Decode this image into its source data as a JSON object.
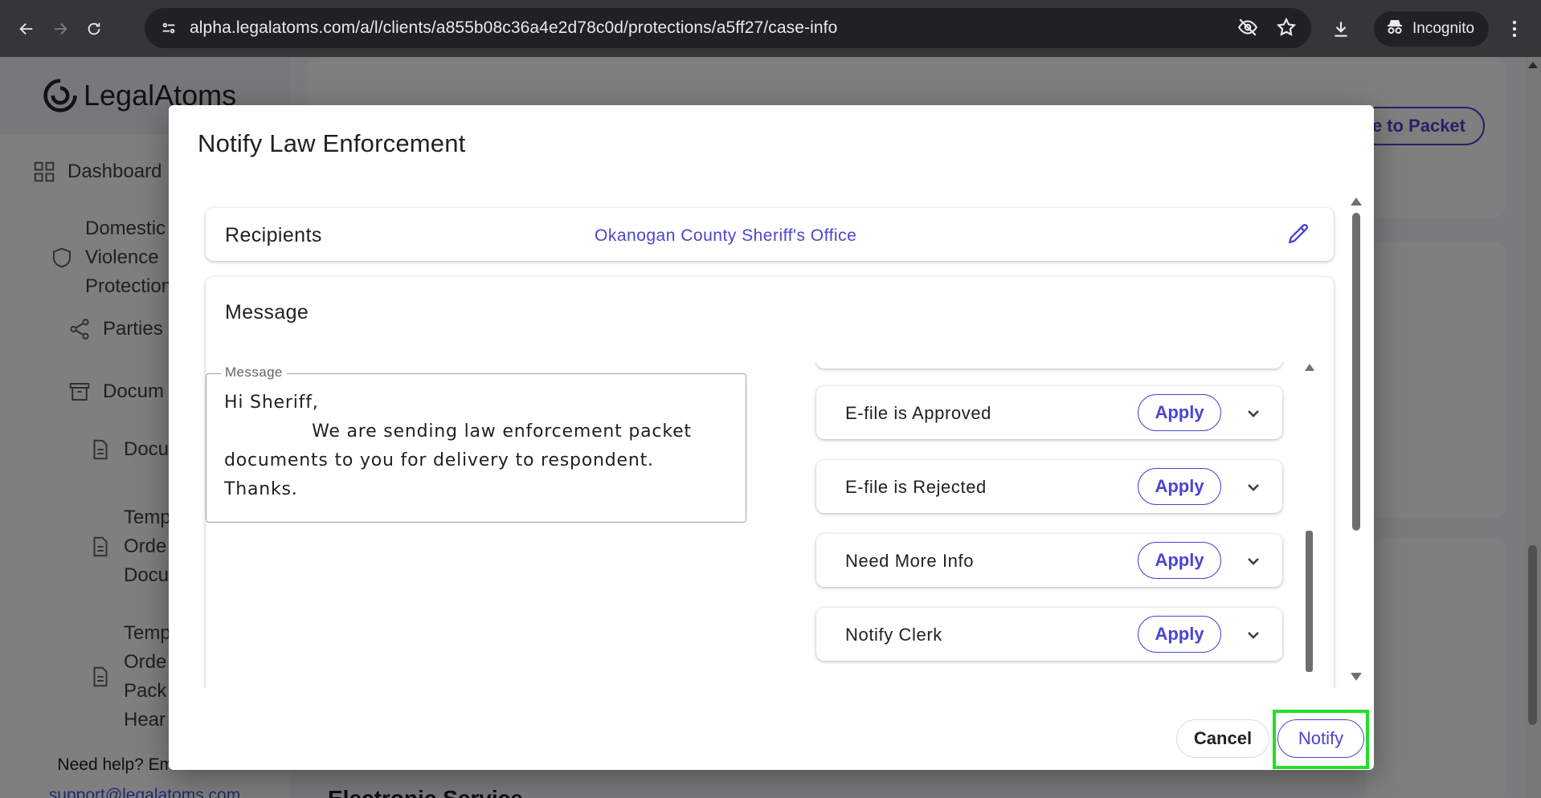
{
  "browser": {
    "url": "alpha.legalatoms.com/a/l/clients/a855b08c36a4e2d78c0d/protections/a5ff27/case-info",
    "profile_label": "Incognito"
  },
  "sidebar": {
    "logo_text": "LegalAtoms",
    "items": [
      {
        "label": "Dashboard",
        "icon": "dashboard-grid-icon"
      },
      {
        "label": "Domestic\nViolence\nProtection",
        "icon": "shield-icon"
      },
      {
        "label": "Parties",
        "icon": "share-nodes-icon"
      },
      {
        "label": "Docum",
        "icon": "archive-box-icon"
      },
      {
        "label": "Docu",
        "icon": "document-icon"
      },
      {
        "label": "Temp\nOrde\nDocu",
        "icon": "document-icon"
      },
      {
        "label": "Temp\nOrde\nPack\nHear",
        "icon": "document-icon"
      }
    ],
    "help_text": "Need help? Email us at",
    "help_email": "support@legalatoms.com"
  },
  "main": {
    "packet_button_label": "le to Packet",
    "section_heading": "Electronic Service"
  },
  "modal": {
    "title": "Notify Law Enforcement",
    "recipients": {
      "label": "Recipients",
      "value": "Okanogan County Sheriff's Office"
    },
    "message": {
      "heading": "Message",
      "field_label": "Message",
      "field_value": "Hi Sheriff,\n              We are sending law enforcement packet documents to you for delivery to respondent. Thanks."
    },
    "templates": [
      {
        "label": "E-file is Approved",
        "action": "Apply"
      },
      {
        "label": "E-file is Rejected",
        "action": "Apply"
      },
      {
        "label": "Need More Info",
        "action": "Apply"
      },
      {
        "label": "Notify Clerk",
        "action": "Apply"
      }
    ],
    "cancel_label": "Cancel",
    "notify_label": "Notify"
  },
  "colors": {
    "accent": "#4b45d1",
    "highlight": "#22e02a",
    "chrome_bg": "#35363a"
  }
}
